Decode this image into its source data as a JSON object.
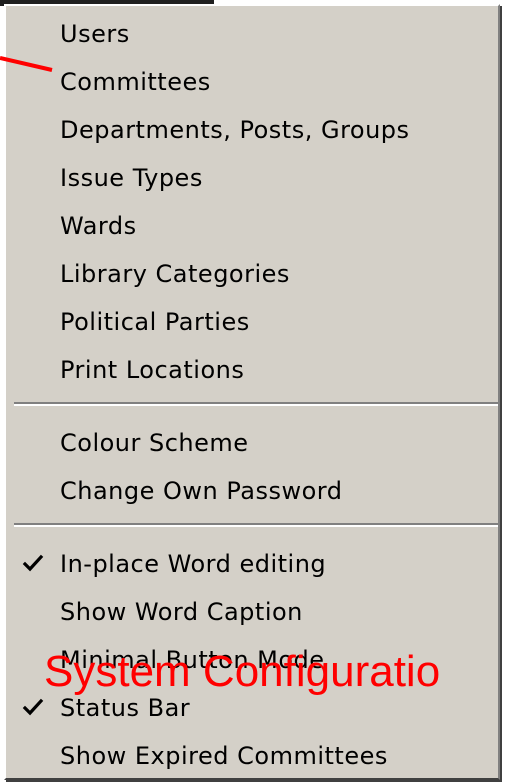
{
  "menu": {
    "group_1": [
      {
        "label": "Users",
        "checked": false
      },
      {
        "label": "Committees",
        "checked": false
      },
      {
        "label": "Departments, Posts, Groups",
        "checked": false
      },
      {
        "label": "Issue Types",
        "checked": false
      },
      {
        "label": "Wards",
        "checked": false
      },
      {
        "label": "Library Categories",
        "checked": false
      },
      {
        "label": "Political Parties",
        "checked": false
      },
      {
        "label": "Print Locations",
        "checked": false
      }
    ],
    "group_2": [
      {
        "label": "Colour Scheme",
        "checked": false
      },
      {
        "label": "Change Own Password",
        "checked": false
      }
    ],
    "group_3": [
      {
        "label": "In-place Word editing",
        "checked": true
      },
      {
        "label": "Show Word Caption",
        "checked": false
      },
      {
        "label": "Minimal Button Mode",
        "checked": false
      },
      {
        "label": "Status Bar",
        "checked": true
      },
      {
        "label": "Show Expired Committees",
        "checked": false
      }
    ]
  },
  "overlay": {
    "caption": "System Configuratio"
  },
  "colors": {
    "menu_background": "#d4d0c8",
    "annotation_red": "#ff0000"
  },
  "icons": {
    "check": "check-icon"
  }
}
